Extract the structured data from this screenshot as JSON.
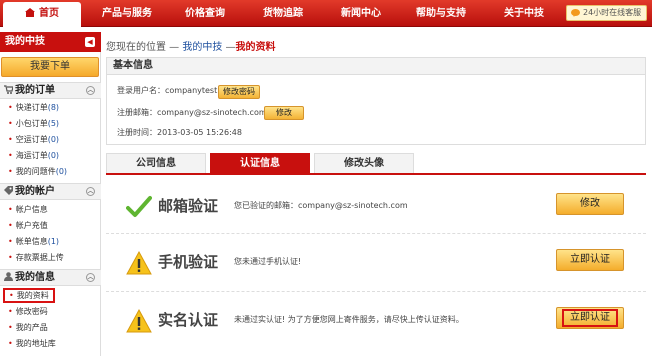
{
  "nav": {
    "home": "首页",
    "items": [
      "产品与服务",
      "价格查询",
      "货物追踪",
      "新闻中心",
      "帮助与支持",
      "关于中技"
    ],
    "hotline": "24小时在线客服"
  },
  "sidebar": {
    "title": "我的中技",
    "order_button": "我要下单",
    "orders": {
      "title": "我的订单",
      "items": [
        {
          "label": "快递订单",
          "count": "(8)"
        },
        {
          "label": "小包订单",
          "count": "(5)"
        },
        {
          "label": "空运订单",
          "count": "(0)"
        },
        {
          "label": "海运订单",
          "count": "(0)"
        },
        {
          "label": "我的问题件",
          "count": "(0)"
        }
      ]
    },
    "account": {
      "title": "我的帐户",
      "items": [
        {
          "label": "帐户信息",
          "count": ""
        },
        {
          "label": "帐户充值",
          "count": ""
        },
        {
          "label": "帐单信息",
          "count": "(1)"
        },
        {
          "label": "存款票据上传",
          "count": ""
        }
      ]
    },
    "info": {
      "title": "我的信息",
      "items": [
        {
          "label": "我的资料",
          "count": ""
        },
        {
          "label": "修改密码",
          "count": ""
        },
        {
          "label": "我的产品",
          "count": ""
        },
        {
          "label": "我的地址库",
          "count": ""
        }
      ]
    }
  },
  "breadcrumb": {
    "prefix": "您现在的位置 — ",
    "link": "我的中技",
    "sep": " —",
    "current": "我的资料"
  },
  "basic": {
    "title": "基本信息",
    "username_label": "登录用户名：",
    "username": "companytest",
    "change_password": "修改密码",
    "email_label": "注册邮箱：",
    "email": "company@sz-sinotech.com",
    "modify": "修改",
    "time_label": "注册时间：",
    "time": "2013-03-05 15:26:48"
  },
  "tabs": [
    "公司信息",
    "认证信息",
    "修改头像"
  ],
  "verify": [
    {
      "title": "邮箱验证",
      "desc": "您已验证的邮箱：company@sz-sinotech.com",
      "button": "修改",
      "status": "ok"
    },
    {
      "title": "手机验证",
      "desc": "您未通过手机认证!",
      "button": "立即认证",
      "status": "warn"
    },
    {
      "title": "实名认证",
      "desc": "未通过实认证! 为了方便您网上寄件服务，请尽快上传认证资料。",
      "button": "立即认证",
      "status": "warn"
    }
  ],
  "colors": {
    "brand_red": "#c8100e",
    "button_orange": "#f4ad2c",
    "link_blue": "#1d4f9e"
  }
}
